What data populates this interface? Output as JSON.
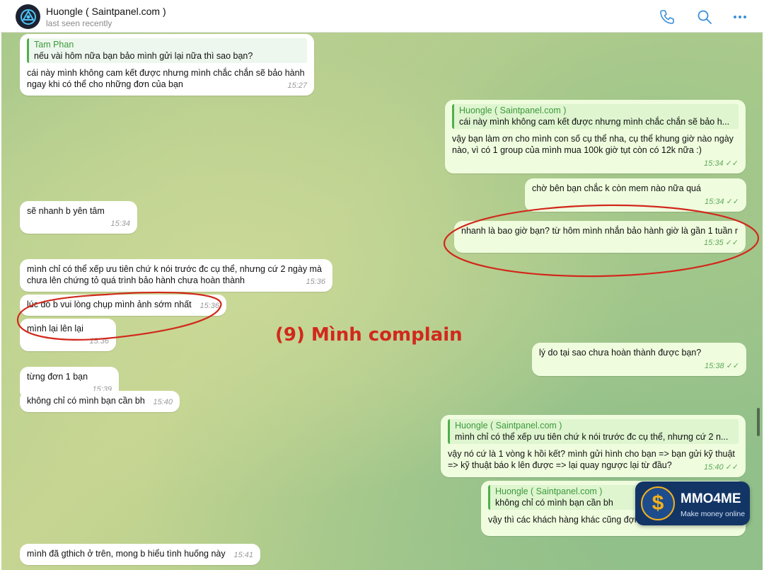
{
  "header": {
    "title": "Huongle ( Saintpanel.com )",
    "status": "last seen recently",
    "icons": [
      "phone-icon",
      "search-icon",
      "more-icon"
    ]
  },
  "overlay_label": "(9) Mình complain",
  "messages": [
    {
      "side": "in",
      "reply_name": "Tam Phan",
      "reply_text": "nếu vài hôm nữa bạn bảo mình gửi lại nữa thì sao bạn?",
      "text": "cái này mình không cam kết được nhưng mình chắc chắn sẽ bảo hành ngay khi có thể cho những đơn của bạn",
      "time": "15:27"
    },
    {
      "side": "out",
      "reply_name": "Huongle ( Saintpanel.com )",
      "reply_text": "cái này mình không cam kết được nhưng mình chắc chắn sẽ bảo h...",
      "text": "vậy bạn làm ơn cho mình con số cụ thể nha, cụ thể khung giờ nào ngày nào, vì có 1 group của mình mua 100k giờ tụt còn có 12k nữa :)",
      "time": "15:34"
    },
    {
      "side": "out",
      "text": "chờ bên bạn chắc k còn mem nào nữa quá",
      "time": "15:34"
    },
    {
      "side": "in",
      "text": "sẽ nhanh b yên tâm",
      "time": "15:34"
    },
    {
      "side": "out",
      "text": "nhanh là bao giờ bạn? từ hôm mình nhắn bảo hành giờ là gần 1 tuần r",
      "time": "15:35"
    },
    {
      "side": "in",
      "text": "mình chỉ có thể xếp ưu tiên chứ k nói trước đc cụ thể, nhưng cứ 2 ngày mà chưa lên chứng tỏ quá trình bảo hành chưa hoàn thành",
      "time": "15:36"
    },
    {
      "side": "in",
      "text": "lúc đó b vui lòng chụp mình ảnh sớm nhất",
      "time": "15:36"
    },
    {
      "side": "in",
      "text": "mình lại lên lại",
      "time": "15:36"
    },
    {
      "side": "out",
      "text": "lý do tại sao chưa hoàn thành được bạn?",
      "time": "15:38"
    },
    {
      "side": "in",
      "text": "từng đơn 1 bạn",
      "time": "15:39"
    },
    {
      "side": "in",
      "text": "không chỉ có mình bạn cần bh",
      "time": "15:40"
    },
    {
      "side": "out",
      "reply_name": "Huongle ( Saintpanel.com )",
      "reply_text": "mình chỉ có thể xếp ưu tiên chứ k nói trước đc cụ thể, nhưng cứ 2 n...",
      "text": "vậy nó cứ là 1 vòng k hồi kết? mình gửi hình cho bạn => bạn gửi kỹ thuật => kỹ thuật báo k lên được => lại quay ngược lại từ đầu?",
      "time": "15:40"
    },
    {
      "side": "out",
      "reply_name": "Huongle ( Saintpanel.com )",
      "reply_text": "không chỉ có mình bạn cần bh",
      "text": "vậy thì các khách hàng khác cũng đợi như bên mình ấy hả bạn",
      "time": ""
    },
    {
      "side": "in",
      "text": "mình đã gthich ở trên, mong b hiểu tình huống này",
      "time": "15:41"
    }
  ],
  "watermark": {
    "name": "MMO4ME",
    "tagline": "Make money online",
    "symbol": "$"
  },
  "colors": {
    "accent": "#4fae4e",
    "outgoing": "#effdde",
    "incoming": "#ffffff",
    "annotation": "#d1291c"
  }
}
